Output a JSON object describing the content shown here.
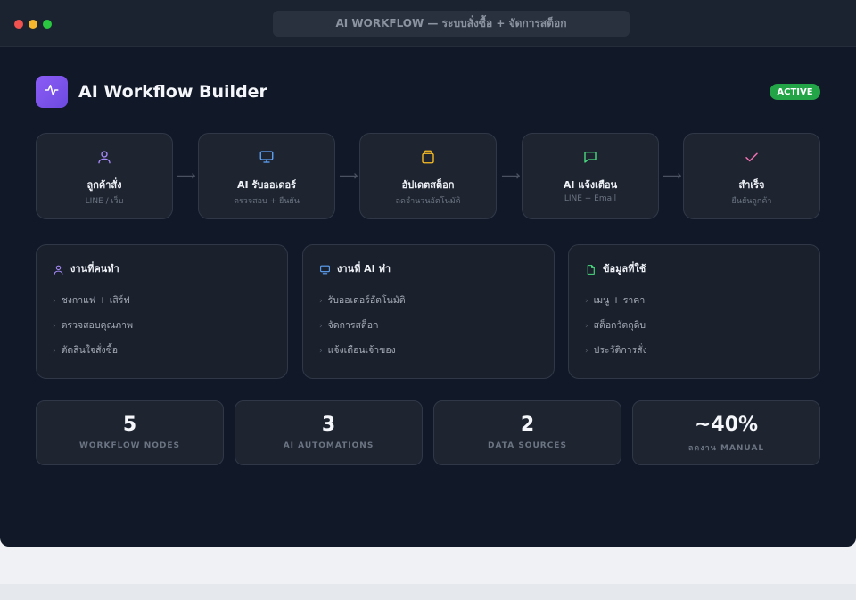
{
  "window": {
    "address_title": "AI WORKFLOW — ระบบสั่งซื้อ + จัดการสต็อก"
  },
  "header": {
    "logo_icon": "activity-pulse-icon",
    "title": "AI Workflow Builder",
    "status_badge": "ACTIVE",
    "badge_color": "#22a447"
  },
  "workflow": {
    "nodes": [
      {
        "icon": "user-icon",
        "color": "#a78bfa",
        "label": "ลูกค้าสั่ง",
        "sub": "LINE / เว็บ"
      },
      {
        "icon": "monitor-icon",
        "color": "#60a5fa",
        "label": "AI รับออเดอร์",
        "sub": "ตรวจสอบ + ยืนยัน"
      },
      {
        "icon": "box-icon",
        "color": "#fbbf24",
        "label": "อัปเดตสต็อก",
        "sub": "ลดจำนวนอัตโนมัติ"
      },
      {
        "icon": "chat-icon",
        "color": "#4ade80",
        "label": "AI แจ้งเตือน",
        "sub": "LINE + Email"
      },
      {
        "icon": "check-icon",
        "color": "#f472b6",
        "label": "สำเร็จ",
        "sub": "ยืนยันลูกค้า"
      }
    ]
  },
  "panels": [
    {
      "icon": "user-icon",
      "color": "#a78bfa",
      "title": "งานที่คนทำ",
      "items": [
        "ชงกาแฟ + เสิร์ฟ",
        "ตรวจสอบคุณภาพ",
        "ตัดสินใจสั่งซื้อ"
      ]
    },
    {
      "icon": "monitor-icon",
      "color": "#60a5fa",
      "title": "งานที่ AI ทำ",
      "items": [
        "รับออเดอร์อัตโนมัติ",
        "จัดการสต็อก",
        "แจ้งเตือนเจ้าของ"
      ]
    },
    {
      "icon": "document-icon",
      "color": "#4ade80",
      "title": "ข้อมูลที่ใช้",
      "items": [
        "เมนู + ราคา",
        "สต็อกวัตถุดิบ",
        "ประวัติการสั่ง"
      ]
    }
  ],
  "stats": [
    {
      "value": "5",
      "label": "WORKFLOW NODES"
    },
    {
      "value": "3",
      "label": "AI AUTOMATIONS"
    },
    {
      "value": "2",
      "label": "DATA SOURCES"
    },
    {
      "value": "~40%",
      "label": "ลดงาน MANUAL"
    }
  ]
}
